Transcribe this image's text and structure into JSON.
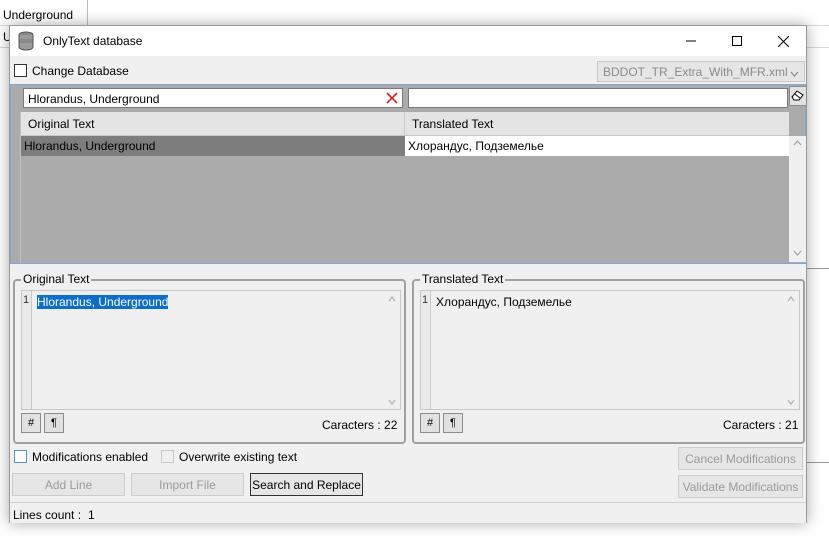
{
  "background": {
    "rows": [
      "Underground",
      "U"
    ]
  },
  "window": {
    "title": "OnlyText database",
    "icons": {
      "app": "database-icon",
      "minimize": "minimize-icon",
      "maximize": "maximize-icon",
      "close": "close-icon"
    }
  },
  "top": {
    "change_db_label": "Change Database",
    "change_db_checked": false,
    "db_select_value": "BDDOT_TR_Extra_With_MFR.xml"
  },
  "search": {
    "original_value": "Hlorandus, Underground",
    "translated_value": ""
  },
  "grid": {
    "columns": [
      "Original Text",
      "Translated Text"
    ],
    "rows": [
      {
        "original": "Hlorandus, Underground",
        "translated": "Хлорандус, Подземелье"
      }
    ]
  },
  "original_panel": {
    "title": "Original Text",
    "line_number": "1",
    "text": "Hlorandus, Underground",
    "hash_button": "#",
    "pilcrow_button": "¶",
    "char_count": "Caracters : 22"
  },
  "translated_panel": {
    "title": "Translated Text",
    "line_number": "1",
    "text": "Хлорандус, Подземелье",
    "hash_button": "#",
    "pilcrow_button": "¶",
    "char_count": "Caracters : 21"
  },
  "options": {
    "modifications_label": "Modifications enabled",
    "overwrite_label": "Overwrite existing text"
  },
  "buttons": {
    "add_line": "Add Line",
    "import_file": "Import File",
    "search_replace": "Search and Replace",
    "cancel_mods": "Cancel Modifications",
    "validate_mods": "Validate Modifications"
  },
  "status": {
    "lines_count_label": "Lines count :",
    "lines_count_value": "1"
  }
}
